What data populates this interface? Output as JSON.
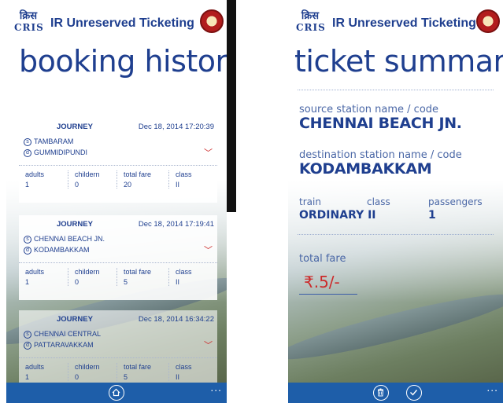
{
  "left_screen": {
    "app_title": "IR Unreserved Ticketing",
    "logo_glyph": "क्रिस",
    "logo_word": "CRIS",
    "page_title": "booking history",
    "journeys": [
      {
        "label": "JOURNEY",
        "datetime": "Dec 18, 2014 17:20:39",
        "source": "TAMBARAM",
        "destination": "GUMMIDIPUNDI",
        "adults_label": "adults",
        "adults": "1",
        "children_label": "childern",
        "children": "0",
        "fare_label": "total fare",
        "fare": "20",
        "class_label": "class",
        "class": "II"
      },
      {
        "label": "JOURNEY",
        "datetime": "Dec 18, 2014 17:19:41",
        "source": "CHENNAI BEACH JN.",
        "destination": "KODAMBAKKAM",
        "adults_label": "adults",
        "adults": "1",
        "children_label": "childern",
        "children": "0",
        "fare_label": "total fare",
        "fare": "5",
        "class_label": "class",
        "class": "II"
      },
      {
        "label": "JOURNEY",
        "datetime": "Dec 18, 2014 16:34:22",
        "source": "CHENNAI CENTRAL",
        "destination": "PATTARAVAKKAM",
        "adults_label": "adults",
        "adults": "1",
        "children_label": "childern",
        "children": "0",
        "fare_label": "total fare",
        "fare": "5",
        "class_label": "class",
        "class": "II"
      }
    ],
    "source_badge": "s",
    "destination_badge": "d",
    "expand_icon": "chevron-down-icon",
    "appbar": {
      "home_icon": "home-icon",
      "more": "..."
    }
  },
  "right_screen": {
    "app_title": "IR Unreserved Ticketing",
    "logo_glyph": "क्रिस",
    "logo_word": "CRIS",
    "page_title": "ticket summary",
    "source_label": "source station name / code",
    "source_value": "CHENNAI BEACH JN.",
    "destination_label": "destination station name / code",
    "destination_value": "KODAMBAKKAM",
    "train_label": "train",
    "class_label": "class",
    "passengers_label": "passengers",
    "train_class_value": "ORDINARY II",
    "passengers_value": "1",
    "total_fare_label": "total fare",
    "total_fare_value": "₹.5/-",
    "appbar": {
      "delete_icon": "trash-icon",
      "confirm_icon": "check-icon",
      "more": "..."
    }
  },
  "colors": {
    "primary_blue": "#1f3f8f",
    "appbar_blue": "#1e5ea9",
    "accent_red": "#cc2a2a"
  }
}
